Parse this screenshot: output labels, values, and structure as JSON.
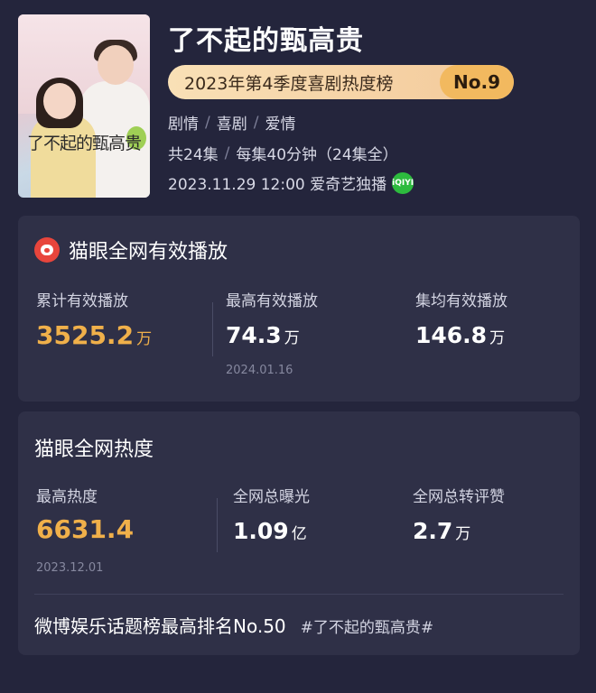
{
  "show": {
    "title": "了不起的甄高贵",
    "poster_title": "了不起的甄高贵",
    "rank_text": "2023年第4季度喜剧热度榜",
    "rank_no": "No.9",
    "genres": [
      "剧情",
      "喜剧",
      "爱情"
    ],
    "episodes": "共24集",
    "duration": "每集40分钟（24集全）",
    "premiere": "2023.11.29 12:00 爱奇艺独播",
    "platform_badge": "iQIYI"
  },
  "playback": {
    "title": "猫眼全网有效播放",
    "total_label": "累计有效播放",
    "total_value": "3525.2",
    "total_unit": "万",
    "peak_label": "最高有效播放",
    "peak_value": "74.3",
    "peak_unit": "万",
    "peak_date": "2024.01.16",
    "avg_label": "集均有效播放",
    "avg_value": "146.8",
    "avg_unit": "万"
  },
  "heat": {
    "title": "猫眼全网热度",
    "peak_label": "最高热度",
    "peak_value": "6631.4",
    "peak_date": "2023.12.01",
    "exposure_label": "全网总曝光",
    "exposure_value": "1.09",
    "exposure_unit": "亿",
    "engage_label": "全网总转评赞",
    "engage_value": "2.7",
    "engage_unit": "万",
    "weibo_text": "微博娱乐话题榜最高排名No.50",
    "weibo_tag": "#了不起的甄高贵#"
  },
  "colors": {
    "accent_gold": "#f0b04a",
    "background": "#24253c",
    "card": "#2f3047",
    "maoyan_red": "#e8453c",
    "iqiyi_green": "#2dbb3e"
  }
}
